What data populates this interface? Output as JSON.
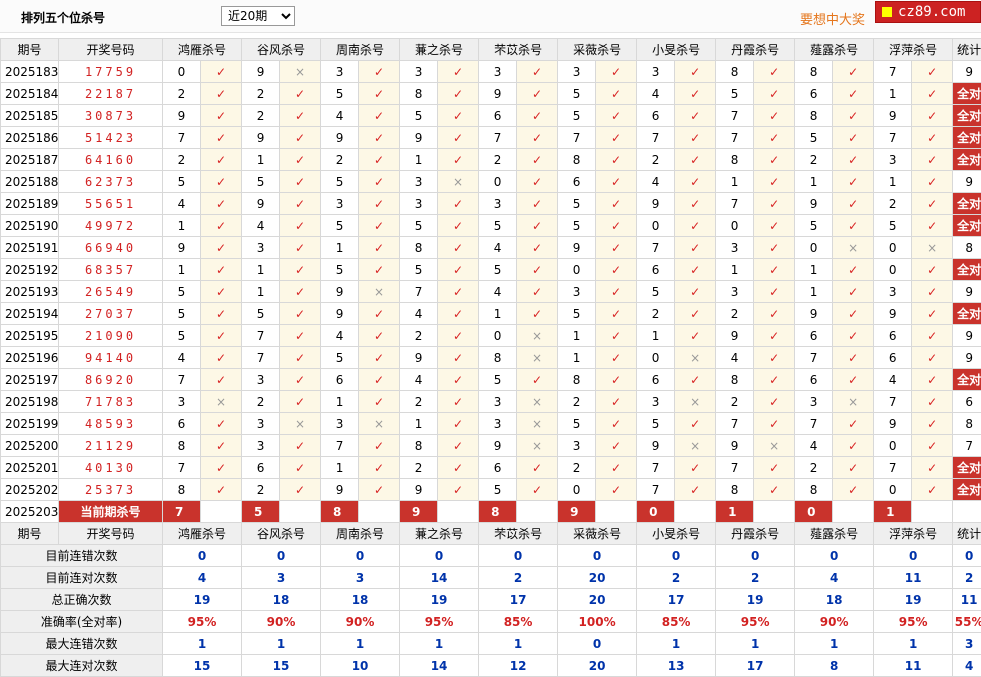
{
  "header": {
    "title": "排列五个位杀号",
    "select_value": "近20期",
    "promo": "要想中大奖",
    "logo_text": "cz89.com"
  },
  "columns": {
    "period": "期号",
    "winning": "开奖号码",
    "experts": [
      "鸿雁杀号",
      "谷风杀号",
      "周南杀号",
      "蒹之杀号",
      "芣苡杀号",
      "采薇杀号",
      "小旻杀号",
      "丹霞杀号",
      "薤露杀号",
      "浮萍杀号"
    ],
    "total": "统计"
  },
  "rows": [
    {
      "period": "2025183",
      "number": "17759",
      "kills": [
        "0",
        "9",
        "3",
        "3",
        "3",
        "3",
        "3",
        "8",
        "8",
        "7"
      ],
      "hits": [
        1,
        0,
        1,
        1,
        1,
        1,
        1,
        1,
        1,
        1
      ],
      "total": "9"
    },
    {
      "period": "2025184",
      "number": "22187",
      "kills": [
        "2",
        "2",
        "5",
        "8",
        "9",
        "5",
        "4",
        "5",
        "6",
        "1"
      ],
      "hits": [
        1,
        1,
        1,
        1,
        1,
        1,
        1,
        1,
        1,
        1
      ],
      "total": "全对"
    },
    {
      "period": "2025185",
      "number": "30873",
      "kills": [
        "9",
        "2",
        "4",
        "5",
        "6",
        "5",
        "6",
        "7",
        "8",
        "9"
      ],
      "hits": [
        1,
        1,
        1,
        1,
        1,
        1,
        1,
        1,
        1,
        1
      ],
      "total": "全对"
    },
    {
      "period": "2025186",
      "number": "51423",
      "kills": [
        "7",
        "9",
        "9",
        "9",
        "7",
        "7",
        "7",
        "7",
        "5",
        "7"
      ],
      "hits": [
        1,
        1,
        1,
        1,
        1,
        1,
        1,
        1,
        1,
        1
      ],
      "total": "全对"
    },
    {
      "period": "2025187",
      "number": "64160",
      "kills": [
        "2",
        "1",
        "2",
        "1",
        "2",
        "8",
        "2",
        "8",
        "2",
        "3"
      ],
      "hits": [
        1,
        1,
        1,
        1,
        1,
        1,
        1,
        1,
        1,
        1
      ],
      "total": "全对"
    },
    {
      "period": "2025188",
      "number": "62373",
      "kills": [
        "5",
        "5",
        "5",
        "3",
        "0",
        "6",
        "4",
        "1",
        "1",
        "1"
      ],
      "hits": [
        1,
        1,
        1,
        0,
        1,
        1,
        1,
        1,
        1,
        1
      ],
      "total": "9"
    },
    {
      "period": "2025189",
      "number": "55651",
      "kills": [
        "4",
        "9",
        "3",
        "3",
        "3",
        "5",
        "9",
        "7",
        "9",
        "2"
      ],
      "hits": [
        1,
        1,
        1,
        1,
        1,
        1,
        1,
        1,
        1,
        1
      ],
      "total": "全对"
    },
    {
      "period": "2025190",
      "number": "49972",
      "kills": [
        "1",
        "4",
        "5",
        "5",
        "5",
        "5",
        "0",
        "0",
        "5",
        "5"
      ],
      "hits": [
        1,
        1,
        1,
        1,
        1,
        1,
        1,
        1,
        1,
        1
      ],
      "total": "全对"
    },
    {
      "period": "2025191",
      "number": "66940",
      "kills": [
        "9",
        "3",
        "1",
        "8",
        "4",
        "9",
        "7",
        "3",
        "0",
        "0"
      ],
      "hits": [
        1,
        1,
        1,
        1,
        1,
        1,
        1,
        1,
        0,
        0
      ],
      "total": "8"
    },
    {
      "period": "2025192",
      "number": "68357",
      "kills": [
        "1",
        "1",
        "5",
        "5",
        "5",
        "0",
        "6",
        "1",
        "1",
        "0"
      ],
      "hits": [
        1,
        1,
        1,
        1,
        1,
        1,
        1,
        1,
        1,
        1
      ],
      "total": "全对"
    },
    {
      "period": "2025193",
      "number": "26549",
      "kills": [
        "5",
        "1",
        "9",
        "7",
        "4",
        "3",
        "5",
        "3",
        "1",
        "3"
      ],
      "hits": [
        1,
        1,
        0,
        1,
        1,
        1,
        1,
        1,
        1,
        1
      ],
      "total": "9"
    },
    {
      "period": "2025194",
      "number": "27037",
      "kills": [
        "5",
        "5",
        "9",
        "4",
        "1",
        "5",
        "2",
        "2",
        "9",
        "9"
      ],
      "hits": [
        1,
        1,
        1,
        1,
        1,
        1,
        1,
        1,
        1,
        1
      ],
      "total": "全对"
    },
    {
      "period": "2025195",
      "number": "21090",
      "kills": [
        "5",
        "7",
        "4",
        "2",
        "0",
        "1",
        "1",
        "9",
        "6",
        "6"
      ],
      "hits": [
        1,
        1,
        1,
        1,
        0,
        1,
        1,
        1,
        1,
        1
      ],
      "total": "9"
    },
    {
      "period": "2025196",
      "number": "94140",
      "kills": [
        "4",
        "7",
        "5",
        "9",
        "8",
        "1",
        "0",
        "4",
        "7",
        "6"
      ],
      "hits": [
        1,
        1,
        1,
        1,
        0,
        1,
        0,
        1,
        1,
        1
      ],
      "total": "9"
    },
    {
      "period": "2025197",
      "number": "86920",
      "kills": [
        "7",
        "3",
        "6",
        "4",
        "5",
        "8",
        "6",
        "8",
        "6",
        "4"
      ],
      "hits": [
        1,
        1,
        1,
        1,
        1,
        1,
        1,
        1,
        1,
        1
      ],
      "total": "全对"
    },
    {
      "period": "2025198",
      "number": "71783",
      "kills": [
        "3",
        "2",
        "1",
        "2",
        "3",
        "2",
        "3",
        "2",
        "3",
        "7"
      ],
      "hits": [
        0,
        1,
        1,
        1,
        0,
        1,
        0,
        1,
        0,
        1
      ],
      "total": "6"
    },
    {
      "period": "2025199",
      "number": "48593",
      "kills": [
        "6",
        "3",
        "3",
        "1",
        "3",
        "5",
        "5",
        "7",
        "7",
        "9"
      ],
      "hits": [
        1,
        0,
        0,
        1,
        0,
        1,
        1,
        1,
        1,
        1
      ],
      "total": "8"
    },
    {
      "period": "2025200",
      "number": "21129",
      "kills": [
        "8",
        "3",
        "7",
        "8",
        "9",
        "3",
        "9",
        "9",
        "4",
        "0"
      ],
      "hits": [
        1,
        1,
        1,
        1,
        0,
        1,
        0,
        0,
        1,
        1
      ],
      "total": "7"
    },
    {
      "period": "2025201",
      "number": "40130",
      "kills": [
        "7",
        "6",
        "1",
        "2",
        "6",
        "2",
        "7",
        "7",
        "2",
        "7"
      ],
      "hits": [
        1,
        1,
        1,
        1,
        1,
        1,
        1,
        1,
        1,
        1
      ],
      "total": "全对"
    },
    {
      "period": "2025202",
      "number": "25373",
      "kills": [
        "8",
        "2",
        "9",
        "9",
        "5",
        "0",
        "7",
        "8",
        "8",
        "0"
      ],
      "hits": [
        1,
        1,
        1,
        1,
        1,
        1,
        1,
        1,
        1,
        1
      ],
      "total": "全对"
    }
  ],
  "current": {
    "period": "2025203",
    "label": "当前期杀号",
    "kills": [
      "7",
      "5",
      "8",
      "9",
      "8",
      "9",
      "0",
      "1",
      "0",
      "1"
    ]
  },
  "stats_rows": [
    {
      "label": "目前连错次数",
      "values": [
        "0",
        "0",
        "0",
        "0",
        "0",
        "0",
        "0",
        "0",
        "0",
        "0"
      ],
      "total": "0"
    },
    {
      "label": "目前连对次数",
      "values": [
        "4",
        "3",
        "3",
        "14",
        "2",
        "20",
        "2",
        "2",
        "4",
        "11"
      ],
      "total": "2"
    },
    {
      "label": "总正确次数",
      "values": [
        "19",
        "18",
        "18",
        "19",
        "17",
        "20",
        "17",
        "19",
        "18",
        "19"
      ],
      "total": "11"
    },
    {
      "label": "准确率(全对率)",
      "values": [
        "95%",
        "90%",
        "90%",
        "95%",
        "85%",
        "100%",
        "85%",
        "95%",
        "90%",
        "95%"
      ],
      "total": "55%",
      "rate": true
    },
    {
      "label": "最大连错次数",
      "values": [
        "1",
        "1",
        "1",
        "1",
        "1",
        "0",
        "1",
        "1",
        "1",
        "1"
      ],
      "total": "3"
    },
    {
      "label": "最大连对次数",
      "values": [
        "15",
        "15",
        "10",
        "14",
        "12",
        "20",
        "13",
        "17",
        "8",
        "11"
      ],
      "total": "4"
    }
  ],
  "marks": {
    "hit": "✓",
    "miss": "×"
  },
  "colors": {
    "accent_red": "#c9332c",
    "hit_red": "#d82424",
    "stat_blue": "#0033aa",
    "promo_orange": "#e5761c"
  }
}
